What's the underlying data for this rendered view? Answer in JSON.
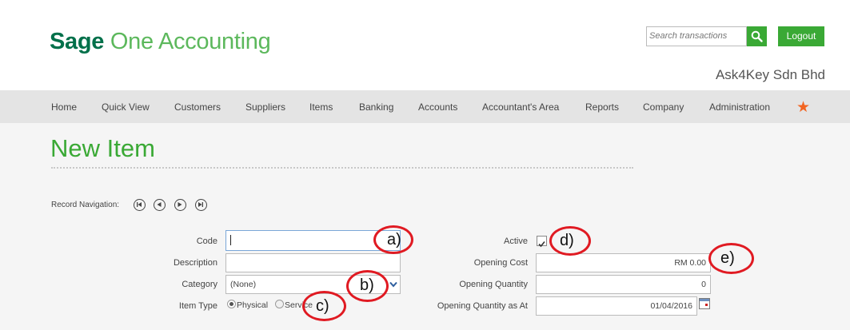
{
  "header": {
    "logo_bold": "Sage",
    "logo_rest": " One Accounting",
    "search_placeholder": "Search transactions",
    "logout_label": "Logout",
    "company_name": "Ask4Key Sdn Bhd"
  },
  "nav": {
    "items": [
      "Home",
      "Quick View",
      "Customers",
      "Suppliers",
      "Items",
      "Banking",
      "Accounts",
      "Accountant's Area",
      "Reports",
      "Company",
      "Administration"
    ]
  },
  "page": {
    "title": "New Item",
    "record_navigation_label": "Record Navigation:"
  },
  "form": {
    "code_label": "Code",
    "code_value": "",
    "description_label": "Description",
    "description_value": "",
    "category_label": "Category",
    "category_value": "(None)",
    "item_type_label": "Item Type",
    "item_type_options": [
      "Physical",
      "Service"
    ],
    "item_type_selected": "Physical",
    "active_label": "Active",
    "active_checked": true,
    "opening_cost_label": "Opening Cost",
    "opening_cost_value": "RM 0.00",
    "opening_quantity_label": "Opening Quantity",
    "opening_quantity_value": "0",
    "opening_quantity_as_at_label": "Opening Quantity as At",
    "opening_quantity_as_at_value": "01/04/2016"
  },
  "annotations": {
    "a": "a)",
    "b": "b)",
    "c": "c)",
    "d": "d)",
    "e": "e)"
  },
  "colors": {
    "brand_dark": "#00704a",
    "brand_green": "#3aa935",
    "favourite_star": "#f26522",
    "annotation_red": "#e01a22"
  },
  "icons": [
    "search-icon",
    "star-icon",
    "first-record-icon",
    "previous-record-icon",
    "next-record-icon",
    "last-record-icon",
    "calendar-icon",
    "dropdown-arrow-icon"
  ]
}
